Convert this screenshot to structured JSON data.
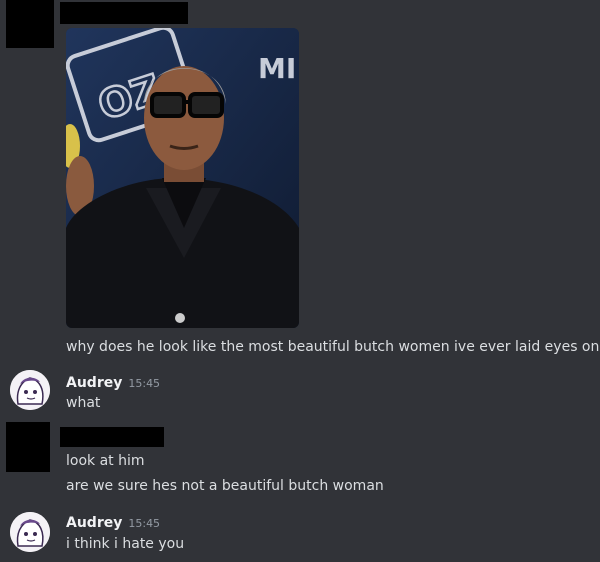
{
  "messages": {
    "caption": "why does he look like the most beautiful butch women ive ever laid eyes on",
    "group1": {
      "username": "Audrey",
      "time": "15:45",
      "text": "what"
    },
    "group2": {
      "line1": "look at him",
      "line2": "are we sure hes not a beautiful butch woman"
    },
    "group3": {
      "username": "Audrey",
      "time": "15:45",
      "text": "i think i hate you"
    }
  },
  "image": {
    "sign_left": "OZ",
    "sign_right": "MI N"
  },
  "colors": {
    "background": "#313338",
    "text": "#dbdee1",
    "username": "#f2f3f5",
    "timestamp": "#949ba4",
    "redaction": "#000000"
  }
}
